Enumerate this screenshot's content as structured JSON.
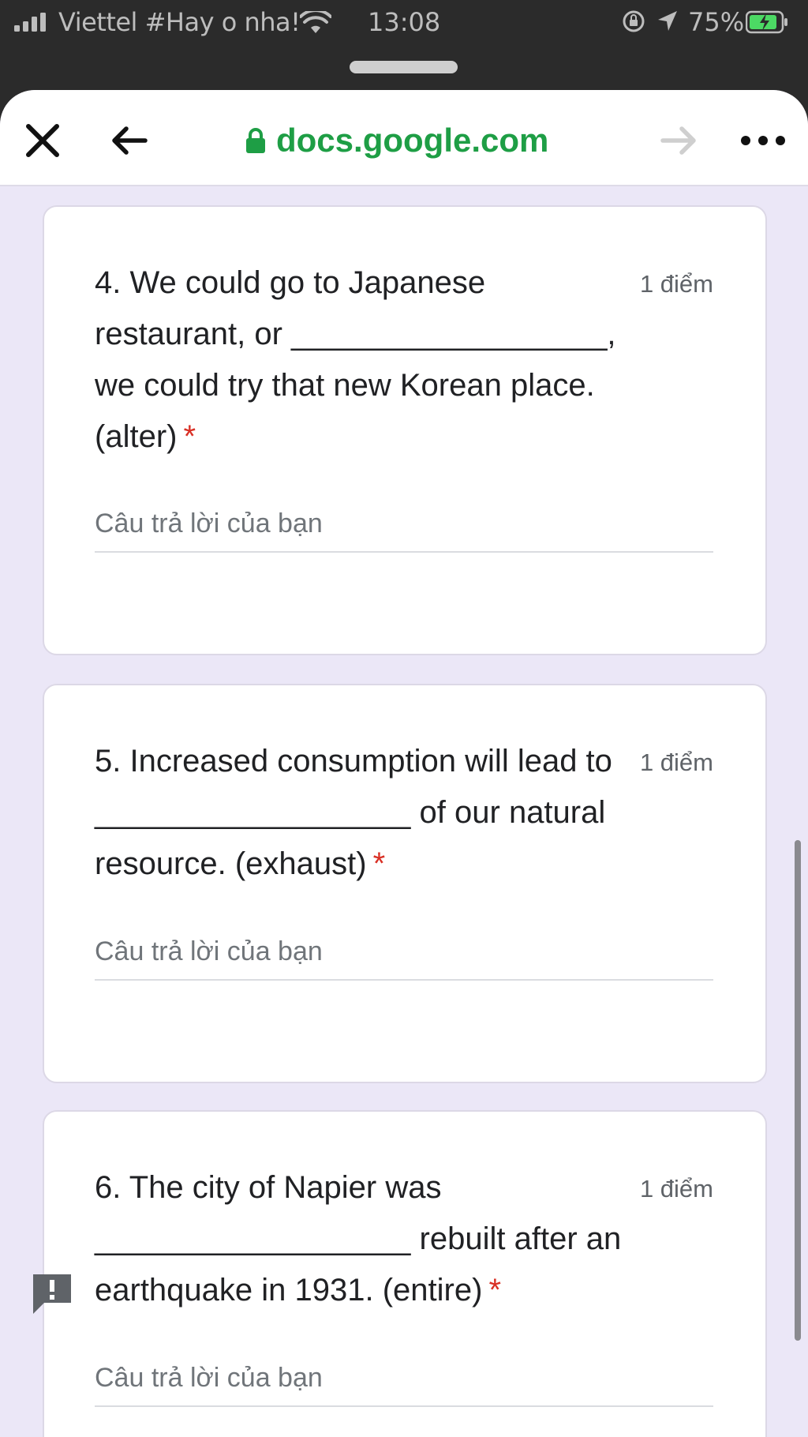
{
  "status_bar": {
    "carrier": "Viettel #Hay o nha!",
    "time": "13:08",
    "battery_percent": "75%"
  },
  "browser": {
    "url": "docs.google.com"
  },
  "questions": [
    {
      "text": "4. We could go to Japanese restaurant, or __________________, we could try that new Korean place. (alter)",
      "required_mark": "*",
      "points": "1 điểm",
      "placeholder": "Câu trả lời của bạn"
    },
    {
      "text": "5. Increased consumption will lead to __________________ of our natural resource. (exhaust)",
      "required_mark": "*",
      "points": "1 điểm",
      "placeholder": "Câu trả lời của bạn"
    },
    {
      "text": "6. The city of Napier was __________________ rebuilt after an earthquake in 1931. (entire)",
      "required_mark": "*",
      "points": "1 điểm",
      "placeholder": "Câu trả lời của bạn"
    }
  ],
  "icons": {
    "close": "close-icon",
    "back": "back-arrow-icon",
    "forward": "forward-arrow-icon",
    "more": "more-icon",
    "lock": "lock-icon",
    "feedback": "feedback-icon"
  },
  "colors": {
    "url_green": "#1e9e45",
    "page_bg": "#ebe7f7",
    "required_red": "#d93025"
  }
}
